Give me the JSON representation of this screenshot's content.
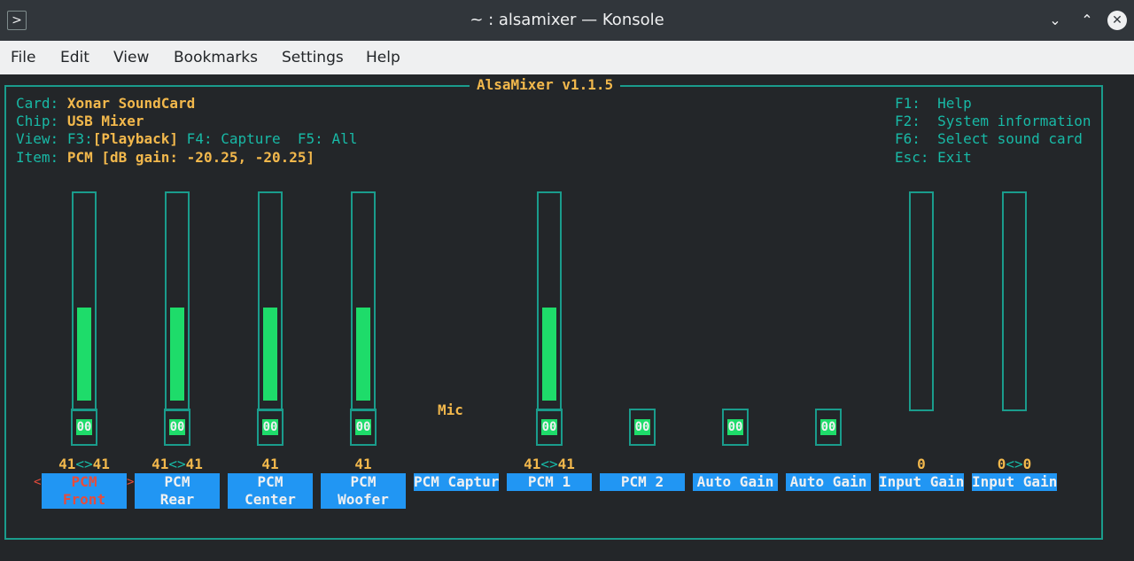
{
  "window": {
    "title": "~ : alsamixer — Konsole",
    "app_icon": ">",
    "minimize": "⌄",
    "maximize": "⌃",
    "close": "✕"
  },
  "menu": [
    "File",
    "Edit",
    "View",
    "Bookmarks",
    "Settings",
    "Help"
  ],
  "mixer": {
    "header": "AlsaMixer v1.1.5",
    "card_label": "Card:",
    "card_value": "Xonar SoundCard",
    "chip_label": "Chip:",
    "chip_value": "USB Mixer",
    "view_label": "View:",
    "view_f3": "F3:",
    "view_playback": "[Playback]",
    "view_rest": " F4: Capture  F5: All",
    "item_label": "Item:",
    "item_value": "PCM [dB gain: -20.25, -20.25]",
    "keys": [
      "F1:  Help",
      "F2:  System information",
      "F6:  Select sound card",
      "Esc: Exit"
    ],
    "mic_label": "Mic",
    "mute_text": "00",
    "left_arrow": "<",
    "right_arrow": ">",
    "controls": [
      {
        "name": "PCM\nFront",
        "value_l": "41",
        "sep": "<>",
        "value_r": "41",
        "level": 0.41,
        "mute": "00",
        "selected": true
      },
      {
        "name": "PCM\nRear",
        "value_l": "41",
        "sep": "<>",
        "value_r": "41",
        "level": 0.41,
        "mute": "00"
      },
      {
        "name": "PCM\nCenter",
        "value_l": "41",
        "sep": "",
        "value_r": "",
        "level": 0.41,
        "mute": "00"
      },
      {
        "name": "PCM\nWoofer",
        "value_l": "41",
        "sep": "",
        "value_r": "",
        "level": 0.41,
        "mute": "00"
      },
      {
        "name": "PCM Captur"
      },
      {
        "name": "PCM 1",
        "value_l": "41",
        "sep": "<>",
        "value_r": "41",
        "level": 0.41,
        "mute": "00"
      },
      {
        "name": "PCM 2",
        "mute": "00"
      },
      {
        "name": "Auto Gain",
        "mute": "00"
      },
      {
        "name": "Auto Gain",
        "mute": "00"
      },
      {
        "name": "Input Gain",
        "value_l": "0",
        "sep": "",
        "value_r": "",
        "level": 0
      },
      {
        "name": "Input Gain",
        "value_l": "0",
        "sep": "<>",
        "value_r": "0",
        "level": 0
      }
    ]
  }
}
